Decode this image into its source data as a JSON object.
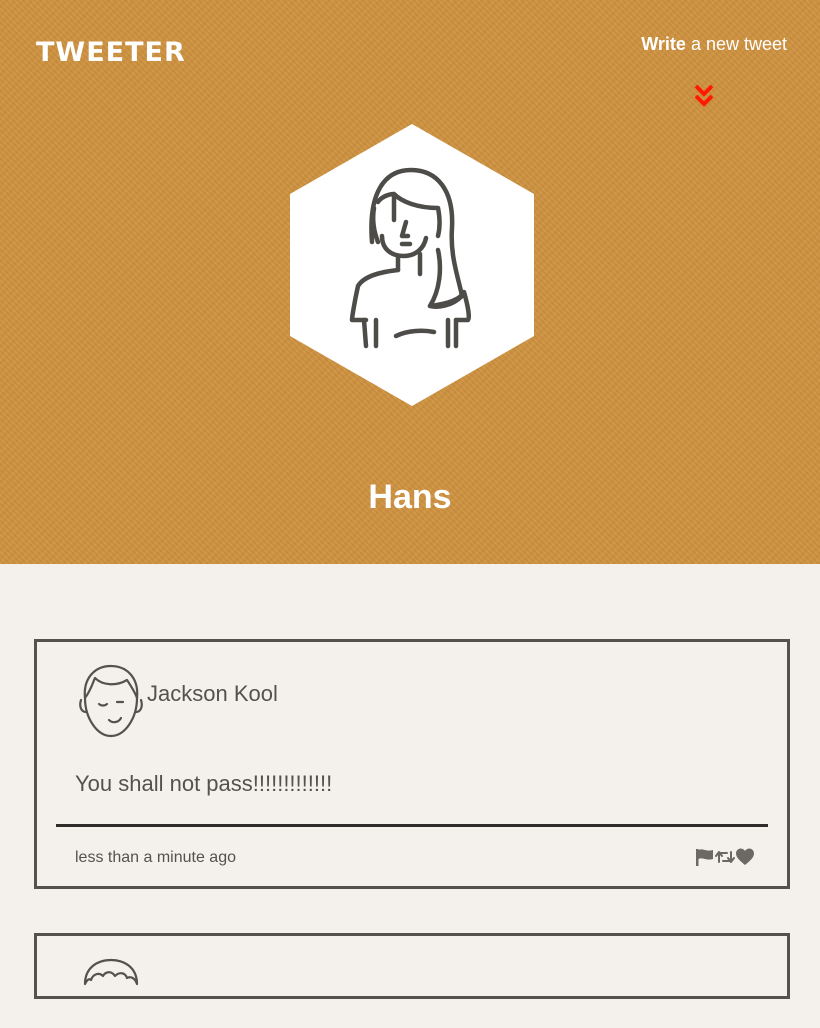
{
  "header": {
    "logo": "TWEETER",
    "compose_strong": "Write",
    "compose_rest": " a new tweet",
    "toggle_icon": "double-chevron-down-icon",
    "toggle_color": "#ff1a00",
    "background_color": "#cf9240"
  },
  "profile": {
    "name": "Hans",
    "avatar_icon": "woman-avatar-icon"
  },
  "tweets": [
    {
      "author": "Jackson Kool",
      "avatar_icon": "man-avatar-icon",
      "text": "You shall not pass!!!!!!!!!!!!!",
      "time": "less than a minute ago",
      "actions": [
        "flag-icon",
        "retweet-icon",
        "heart-icon"
      ]
    },
    {
      "avatar_icon": "curly-hair-avatar-icon"
    }
  ]
}
